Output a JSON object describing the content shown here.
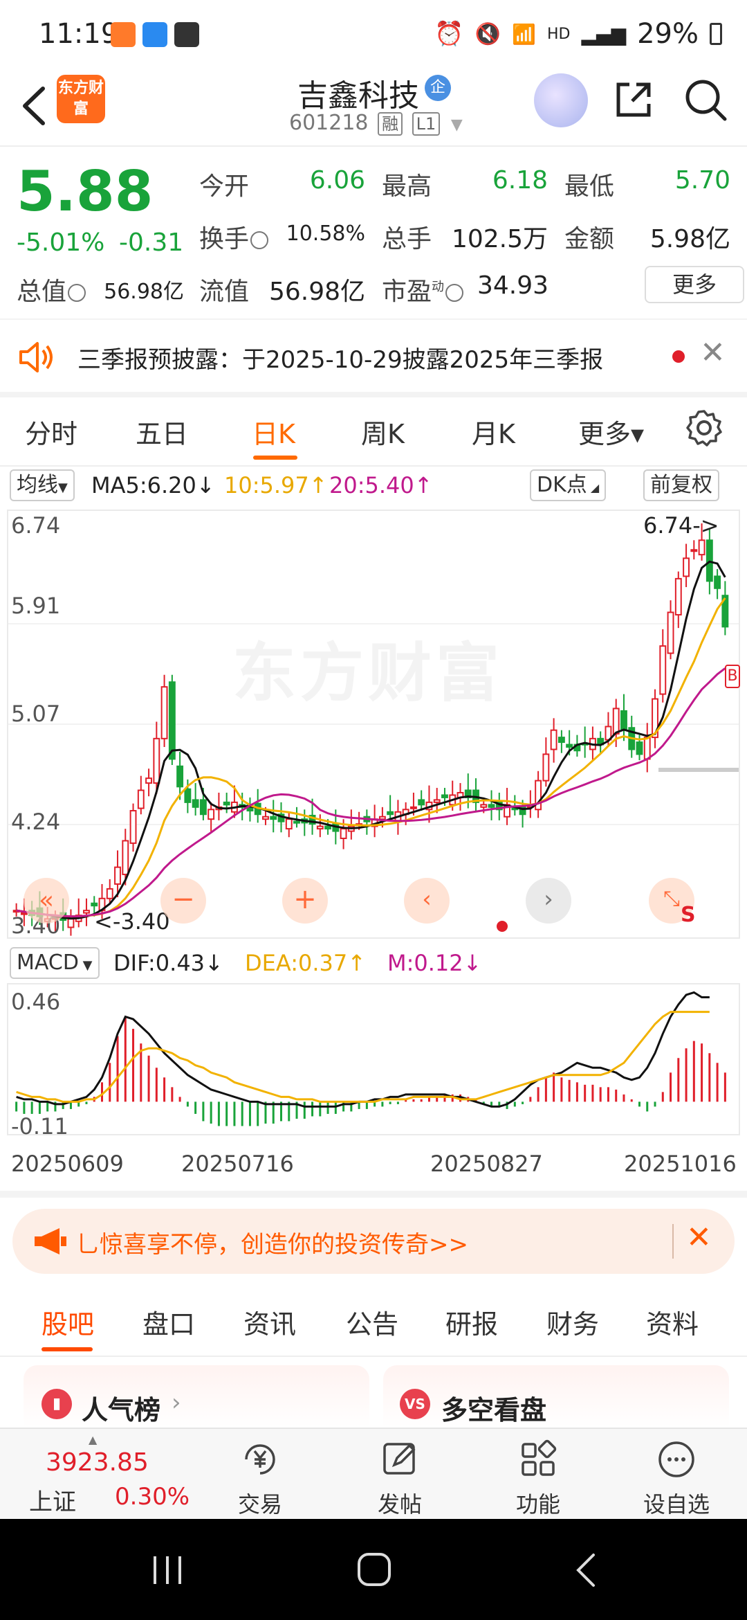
{
  "status_bar": {
    "time": "11:19",
    "battery": "29%",
    "network": "HD"
  },
  "header": {
    "logo_text": "东方财富",
    "stock_name": "吉鑫科技",
    "enterprise_badge": "企",
    "stock_code": "601218",
    "tag_rong": "融",
    "tag_level": "L1"
  },
  "quote": {
    "price": "5.88",
    "change_pct": "-5.01%",
    "change_val": "-0.31",
    "open_label": "今开",
    "open": "6.06",
    "high_label": "最高",
    "high": "6.18",
    "low_label": "最低",
    "low": "5.70",
    "turnover_label": "换手",
    "turnover": "10.58%",
    "volume_label": "总手",
    "volume": "102.5万",
    "amount_label": "金额",
    "amount": "5.98亿",
    "mktcap_label": "总值",
    "mktcap": "56.98亿",
    "float_label": "流值",
    "float_cap": "56.98亿",
    "pe_label": "市盈",
    "pe_sup": "动",
    "pe": "34.93",
    "more_label": "更多"
  },
  "notice": {
    "text": "三季报预披露：于2025-10-29披露2025年三季报"
  },
  "period_tabs": [
    "分时",
    "五日",
    "日K",
    "周K",
    "月K",
    "更多▾"
  ],
  "chart_toolbar": {
    "indicator": "均线",
    "ma5": "MA5:6.20↓",
    "ma10": "10:5.97↑",
    "ma20": "20:5.40↑",
    "dk": "DK点",
    "adjust": "前复权"
  },
  "macd_bar": {
    "name": "MACD",
    "dif": "DIF:0.43↓",
    "dea": "DEA:0.37↑",
    "m": "M:0.12↓"
  },
  "chart_data": [
    {
      "type": "candlestick",
      "y_ticks": [
        "6.74",
        "5.91",
        "5.07",
        "4.24",
        "3.40"
      ],
      "ylim": [
        3.4,
        6.74
      ],
      "max_marker": "6.74->",
      "min_marker": "<-3.40",
      "watermark": "东方财富",
      "x_ticks": [
        "20250609",
        "20250716",
        "20250827",
        "20251016"
      ],
      "close_approx": [
        3.52,
        3.5,
        3.48,
        3.47,
        3.45,
        3.46,
        3.44,
        3.45,
        3.48,
        3.52,
        3.56,
        3.62,
        3.7,
        3.88,
        4.1,
        4.35,
        4.52,
        4.62,
        4.95,
        5.38,
        4.78,
        4.55,
        4.42,
        4.38,
        4.32,
        4.36,
        4.38,
        4.4,
        4.42,
        4.38,
        4.35,
        4.32,
        4.3,
        4.28,
        4.26,
        4.28,
        4.26,
        4.25,
        4.24,
        4.22,
        4.2,
        4.18,
        4.2,
        4.22,
        4.24,
        4.26,
        4.28,
        4.3,
        4.32,
        4.34,
        4.36,
        4.38,
        4.4,
        4.42,
        4.44,
        4.46,
        4.48,
        4.5,
        4.46,
        4.42,
        4.4,
        4.38,
        4.36,
        4.4,
        4.36,
        4.32,
        4.4,
        4.6,
        4.82,
        5.02,
        4.92,
        4.88,
        4.85,
        4.9,
        4.95,
        4.9,
        5.05,
        5.2,
        5.02,
        4.86,
        4.82,
        4.96,
        5.28,
        5.72,
        6.0,
        6.28,
        6.45,
        6.52,
        6.6,
        6.26,
        6.2,
        5.88
      ],
      "ma_series": [
        {
          "name": "MA5",
          "color": "#111111"
        },
        {
          "name": "MA10",
          "color": "#f2b200"
        },
        {
          "name": "MA20",
          "color": "#c0198c"
        }
      ]
    },
    {
      "type": "macd",
      "y_ticks": [
        "0.46",
        "-0.11"
      ],
      "ylim": [
        -0.11,
        0.46
      ],
      "hist": [
        -0.04,
        -0.05,
        -0.05,
        -0.05,
        -0.04,
        -0.04,
        -0.03,
        -0.03,
        -0.02,
        -0.01,
        0.02,
        0.08,
        0.16,
        0.27,
        0.35,
        0.3,
        0.24,
        0.19,
        0.14,
        0.1,
        0.06,
        0.02,
        -0.02,
        -0.05,
        -0.08,
        -0.09,
        -0.1,
        -0.1,
        -0.1,
        -0.1,
        -0.1,
        -0.1,
        -0.09,
        -0.09,
        -0.08,
        -0.08,
        -0.07,
        -0.07,
        -0.06,
        -0.06,
        -0.05,
        -0.05,
        -0.04,
        -0.04,
        -0.03,
        -0.03,
        -0.02,
        -0.02,
        -0.01,
        -0.01,
        0.01,
        0.01,
        0.01,
        0.02,
        0.02,
        0.03,
        0.03,
        0.03,
        0.02,
        0.01,
        -0.01,
        -0.02,
        -0.02,
        -0.03,
        -0.02,
        -0.01,
        0.02,
        0.06,
        0.1,
        0.12,
        0.1,
        0.09,
        0.08,
        0.07,
        0.07,
        0.06,
        0.06,
        0.05,
        0.03,
        0.01,
        -0.02,
        -0.04,
        -0.02,
        0.04,
        0.12,
        0.18,
        0.22,
        0.25,
        0.24,
        0.2,
        0.16,
        0.12
      ],
      "dif": [
        0.02,
        0.01,
        0.01,
        0.0,
        0.0,
        -0.01,
        -0.01,
        0.0,
        0.01,
        0.02,
        0.05,
        0.1,
        0.18,
        0.28,
        0.35,
        0.34,
        0.31,
        0.28,
        0.24,
        0.2,
        0.17,
        0.14,
        0.11,
        0.09,
        0.07,
        0.05,
        0.04,
        0.03,
        0.02,
        0.01,
        0.0,
        0.0,
        -0.01,
        -0.01,
        -0.01,
        -0.01,
        -0.01,
        -0.02,
        -0.02,
        -0.02,
        -0.02,
        -0.02,
        -0.01,
        -0.01,
        0.0,
        0.0,
        0.01,
        0.01,
        0.02,
        0.02,
        0.03,
        0.03,
        0.03,
        0.03,
        0.03,
        0.03,
        0.02,
        0.02,
        0.01,
        0.0,
        -0.01,
        -0.02,
        -0.02,
        -0.01,
        0.01,
        0.04,
        0.07,
        0.09,
        0.1,
        0.11,
        0.12,
        0.14,
        0.16,
        0.15,
        0.14,
        0.14,
        0.13,
        0.12,
        0.1,
        0.09,
        0.1,
        0.14,
        0.2,
        0.28,
        0.35,
        0.4,
        0.44,
        0.45,
        0.43,
        0.43
      ],
      "dea": [
        0.04,
        0.03,
        0.02,
        0.02,
        0.01,
        0.01,
        0.0,
        0.0,
        0.0,
        0.01,
        0.01,
        0.03,
        0.06,
        0.1,
        0.14,
        0.18,
        0.21,
        0.22,
        0.22,
        0.21,
        0.2,
        0.18,
        0.17,
        0.15,
        0.14,
        0.12,
        0.11,
        0.1,
        0.08,
        0.07,
        0.06,
        0.05,
        0.04,
        0.03,
        0.02,
        0.02,
        0.01,
        0.01,
        0.01,
        0.0,
        0.0,
        0.0,
        0.0,
        0.0,
        0.0,
        0.0,
        0.0,
        0.01,
        0.01,
        0.01,
        0.01,
        0.02,
        0.02,
        0.02,
        0.02,
        0.02,
        0.02,
        0.01,
        0.01,
        0.01,
        0.02,
        0.03,
        0.04,
        0.05,
        0.06,
        0.07,
        0.08,
        0.09,
        0.1,
        0.11,
        0.11,
        0.11,
        0.11,
        0.11,
        0.11,
        0.11,
        0.12,
        0.14,
        0.16,
        0.2,
        0.24,
        0.28,
        0.32,
        0.35,
        0.37,
        0.37,
        0.37,
        0.37,
        0.37,
        0.37
      ]
    }
  ],
  "promo": {
    "text": "乚惊喜享不停，创造你的投资传奇>>"
  },
  "section_tabs": [
    "股吧",
    "盘口",
    "资讯",
    "公告",
    "研报",
    "财务",
    "资料"
  ],
  "cards": {
    "left_title": "人气榜",
    "right_title": "多空看盘"
  },
  "bottom_nav": {
    "index_value": "3923.85",
    "index_name": "上证",
    "index_pct": "0.30%",
    "trade": "交易",
    "post": "发帖",
    "func": "功能",
    "watchlist": "设自选"
  },
  "colors": {
    "down_green": "#19a33a",
    "up_red": "#e01f2a",
    "accent_orange": "#ff6a00"
  }
}
